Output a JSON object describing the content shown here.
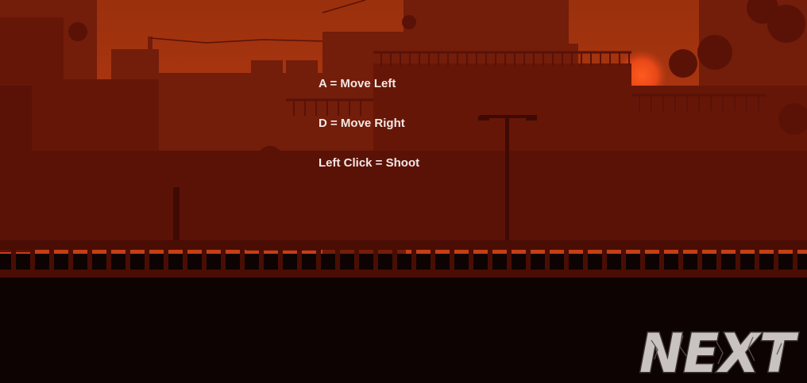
{
  "instructions": {
    "move_left": "A = Move Left",
    "move_right": "D = Move Right",
    "shoot": "Left Click = Shoot"
  },
  "next_button": {
    "label": "NEXT"
  },
  "colors": {
    "sky": "#a63410",
    "sky_glow": "#d8461a",
    "sun": "#ff4a14",
    "building_far": "#731d0b",
    "building_mid": "#661607",
    "building_near": "#5a1207",
    "railing": "#4a0d04",
    "ground": "#0e0303",
    "text": "#f4e8e4",
    "next_fill": "#c8c2c0",
    "next_outline": "#3a3232"
  }
}
